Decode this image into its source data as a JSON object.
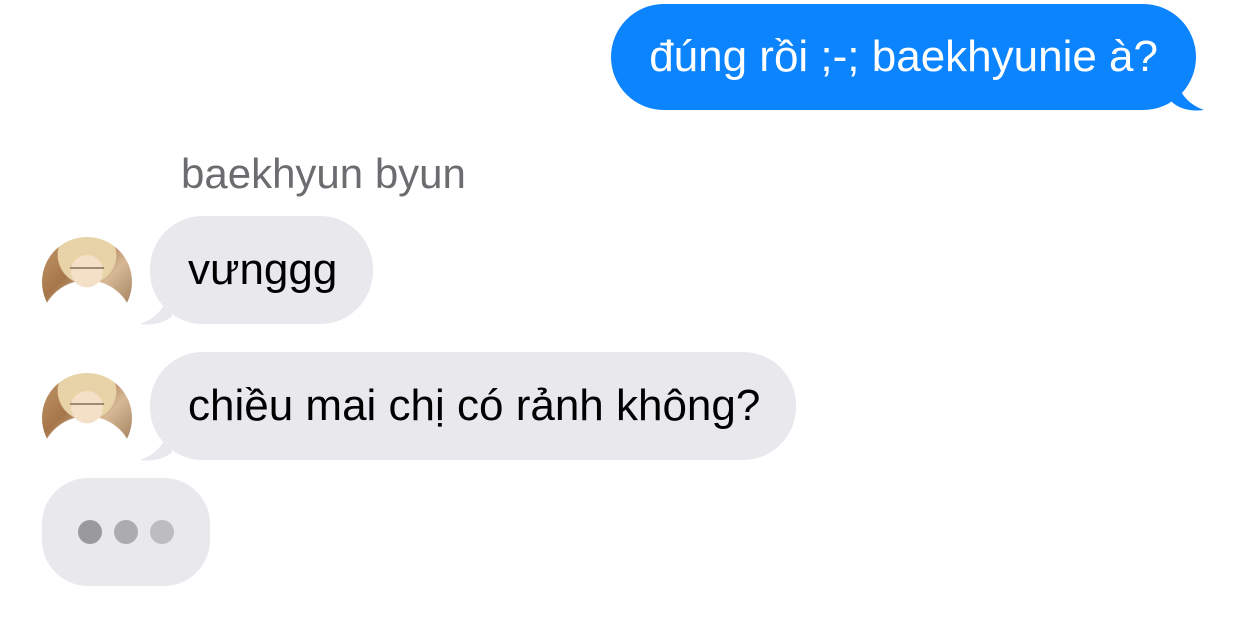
{
  "conversation": {
    "messages": [
      {
        "direction": "outgoing",
        "text": "đúng rồi ;-; baekhyunie à?"
      },
      {
        "direction": "incoming",
        "text": "vưnggg"
      },
      {
        "direction": "incoming",
        "text": "chiều mai chị có rảnh không?"
      }
    ],
    "sender_name": "baekhyun byun",
    "typing_indicator": {
      "dots": 3
    }
  },
  "colors": {
    "outgoing_bubble": "#0b84fe",
    "incoming_bubble": "#e8e8ed",
    "sender_name": "#6c6c70"
  },
  "icons": {
    "avatar": "avatar-photo",
    "typing": "typing-dots-icon"
  }
}
